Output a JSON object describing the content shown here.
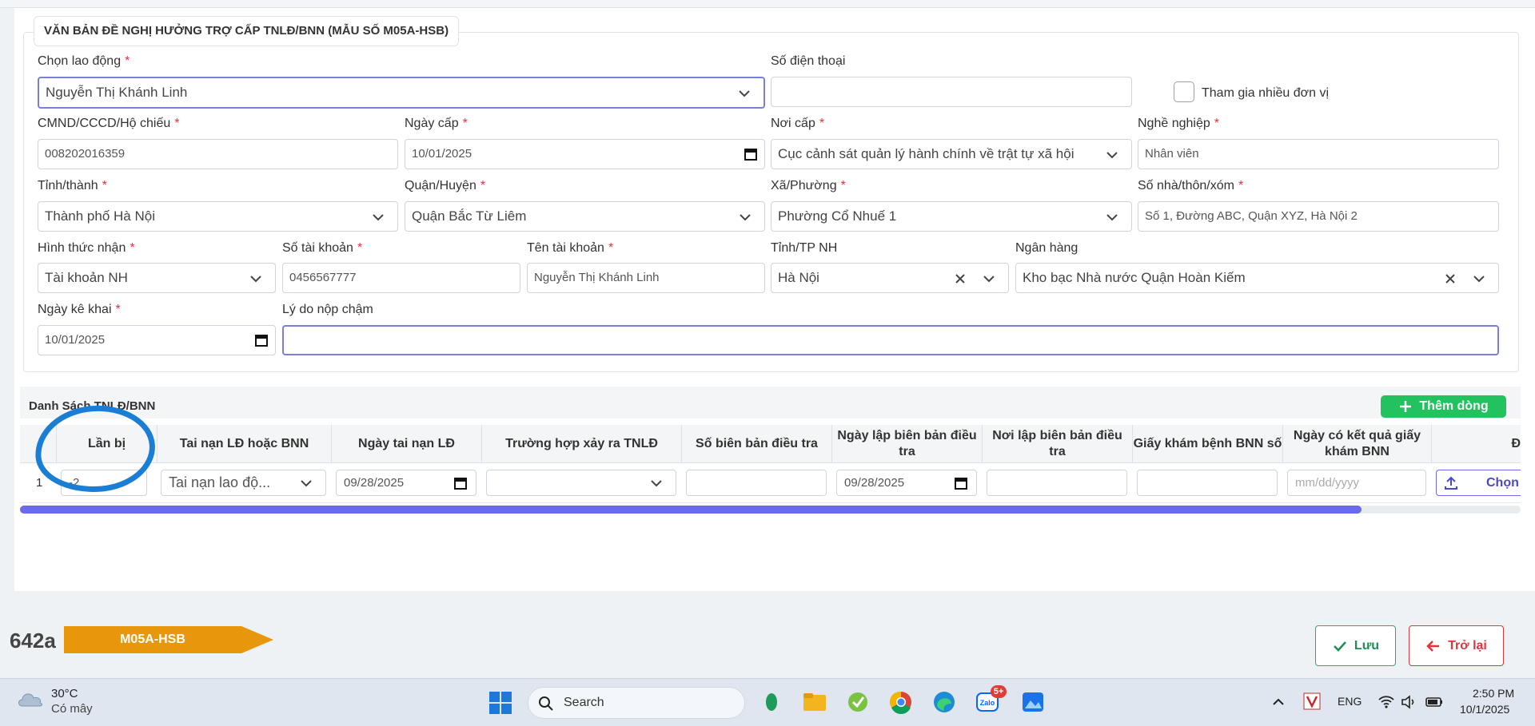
{
  "form": {
    "legend": "VĂN BẢN ĐỀ NGHỊ HƯỞNG TRỢ CẤP TNLĐ/BNN (MẪU SỐ M05A-HSB)",
    "worker_label": "Chọn lao động",
    "worker_value": "Nguyễn Thị Khánh Linh",
    "phone_label": "Số điện thoại",
    "phone_value": "",
    "multi_unit_label": "Tham gia nhiều đơn vị",
    "id_label": "CMND/CCCD/Hộ chiếu",
    "id_value": "008202016359",
    "issue_date_label": "Ngày cấp",
    "issue_date_value": "10/01/2025",
    "issue_place_label": "Nơi cấp",
    "issue_place_value": "Cục cảnh sát quản lý hành chính về trật tự xã hội",
    "job_label": "Nghề nghiệp",
    "job_value": "Nhân viên",
    "province_label": "Tỉnh/thành",
    "province_value": "Thành phố Hà Nội",
    "district_label": "Quận/Huyện",
    "district_value": "Quận Bắc Từ Liêm",
    "ward_label": "Xã/Phường",
    "ward_value": "Phường Cổ Nhuế 1",
    "address_label": "Số nhà/thôn/xóm",
    "address_value": "Số 1, Đường ABC, Quận XYZ, Hà Nội 2",
    "receive_label": "Hình thức nhận",
    "receive_value": "Tài khoản NH",
    "account_no_label": "Số tài khoản",
    "account_no_value": "0456567777",
    "account_name_label": "Tên tài khoản",
    "account_name_value": "Nguyễn Thị Khánh Linh",
    "bank_province_label": "Tỉnh/TP NH",
    "bank_province_value": "Hà Nội",
    "bank_label": "Ngân hàng",
    "bank_value": "Kho bạc Nhà nước Quận Hoàn Kiếm",
    "declare_date_label": "Ngày kê khai",
    "declare_date_value": "10/01/2025",
    "late_reason_label": "Lý do nộp chậm",
    "late_reason_value": ""
  },
  "grid": {
    "title": "Danh Sách TNLĐ/BNN",
    "add_label": "Thêm dòng",
    "columns": [
      "Lần bị",
      "Tai nạn LĐ hoặc BNN",
      "Ngày tai nạn LĐ",
      "Trường hợp xảy ra TNLĐ",
      "Số biên bản điều tra",
      "Ngày lập biên bản điều tra",
      "Nơi lập biên bản điều tra",
      "Giấy khám bệnh BNN số",
      "Ngày có kết quả giấy khám BNN",
      "Đ"
    ],
    "row": {
      "index": "1",
      "times": "-2",
      "type": "Tai nạn lao độ...",
      "accident_date": "09/28/2025",
      "case": "",
      "report_no": "",
      "report_date": "09/28/2025",
      "report_place": "",
      "exam_no": "",
      "exam_date_placeholder": "mm/dd/yyyy",
      "upload_label": "Chọn"
    }
  },
  "footer": {
    "code": "642a",
    "badge": "M05A-HSB",
    "save_label": "Lưu",
    "back_label": "Trở lại"
  },
  "taskbar": {
    "temp": "30°C",
    "weather": "Có mây",
    "search": "Search",
    "lang": "ENG",
    "time": "2:50 PM",
    "date": "10/1/2025",
    "zalo_badge": "5+"
  },
  "colors": {
    "accent": "#6b6ae8",
    "required": "#e0353b",
    "add": "#22c35e",
    "badge": "#e8960c",
    "annotation": "#1a7fd4"
  }
}
